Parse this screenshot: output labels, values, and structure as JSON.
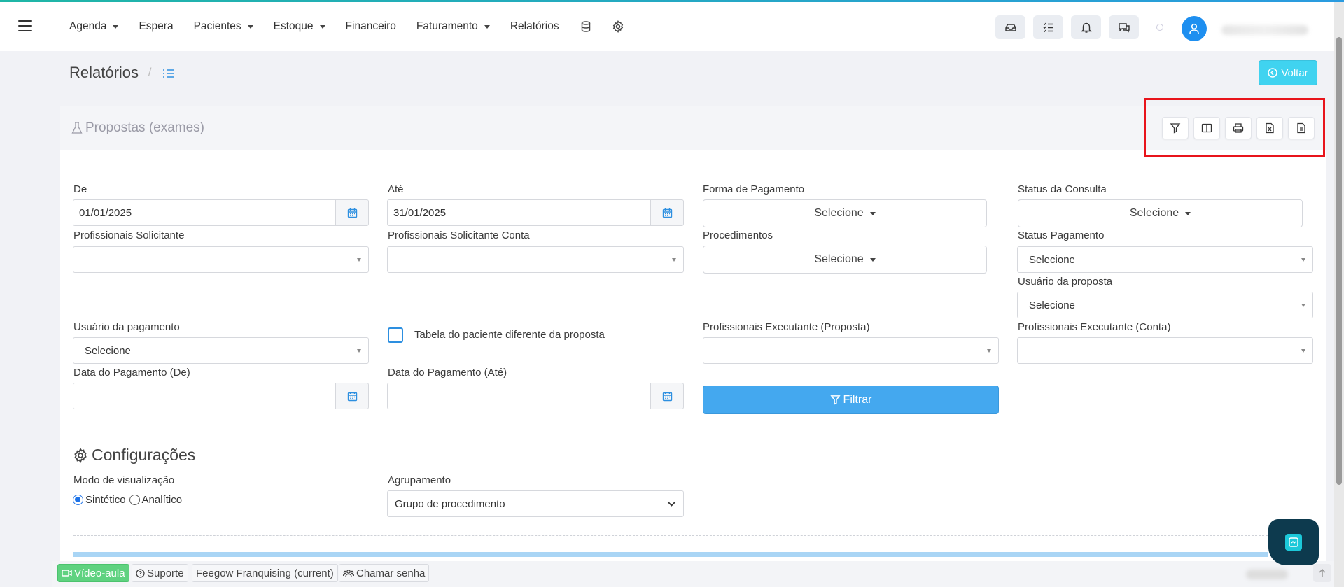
{
  "nav": {
    "items": [
      {
        "label": "Agenda",
        "caret": true
      },
      {
        "label": "Espera",
        "caret": false
      },
      {
        "label": "Pacientes",
        "caret": true
      },
      {
        "label": "Estoque",
        "caret": true
      },
      {
        "label": "Financeiro",
        "caret": false
      },
      {
        "label": "Faturamento",
        "caret": true
      },
      {
        "label": "Relatórios",
        "caret": false
      }
    ],
    "icons": [
      "database-icon",
      "gear-icon"
    ],
    "right_icons": [
      "inbox-icon",
      "checklist-icon",
      "bell-icon",
      "chat-icon"
    ]
  },
  "header": {
    "title": "Relatórios",
    "separator": "/",
    "voltar_label": "Voltar"
  },
  "card": {
    "title": "Propostas (exames)",
    "tools": [
      "filter-icon",
      "columns-icon",
      "print-icon",
      "excel-file-icon",
      "pdf-file-icon"
    ]
  },
  "form": {
    "de": {
      "label": "De",
      "value": "01/01/2025"
    },
    "ate": {
      "label": "Até",
      "value": "31/01/2025"
    },
    "forma_pagamento": {
      "label": "Forma de Pagamento",
      "value": "Selecione"
    },
    "status_consulta": {
      "label": "Status da Consulta",
      "value": "Selecione"
    },
    "prof_solicitante": {
      "label": "Profissionais Solicitante",
      "value": ""
    },
    "prof_solicitante_conta": {
      "label": "Profissionais Solicitante Conta",
      "value": ""
    },
    "procedimentos": {
      "label": "Procedimentos",
      "value": "Selecione"
    },
    "status_pagamento": {
      "label": "Status Pagamento",
      "value": "Selecione"
    },
    "usuario_proposta": {
      "label": "Usuário da proposta",
      "value": "Selecione"
    },
    "usuario_pagamento": {
      "label": "Usuário da pagamento",
      "value": "Selecione"
    },
    "tabela_paciente": {
      "label": "Tabela do paciente diferente da proposta",
      "checked": false
    },
    "prof_exec_proposta": {
      "label": "Profissionais Executante (Proposta)",
      "value": ""
    },
    "prof_exec_conta": {
      "label": "Profissionais Executante (Conta)",
      "value": ""
    },
    "data_pag_de": {
      "label": "Data do Pagamento (De)",
      "value": ""
    },
    "data_pag_ate": {
      "label": "Data do Pagamento (Até)",
      "value": ""
    },
    "filtrar_label": "Filtrar"
  },
  "config": {
    "title": "Configurações",
    "modo_label": "Modo de visualização",
    "modo_options": [
      "Sintético",
      "Analítico"
    ],
    "modo_selected": "Sintético",
    "agrupamento_label": "Agrupamento",
    "agrupamento_value": "Grupo de procedimento"
  },
  "footer": {
    "video_aula": "Vídeo-aula",
    "suporte": "Suporte",
    "franquia": "Feegow Franquising (current)",
    "chamar_senha": "Chamar senha"
  },
  "colors": {
    "accent": "#44a8ef",
    "voltar": "#40d3f0",
    "highlight_box": "#e8141b",
    "video_green": "#5fd280"
  }
}
